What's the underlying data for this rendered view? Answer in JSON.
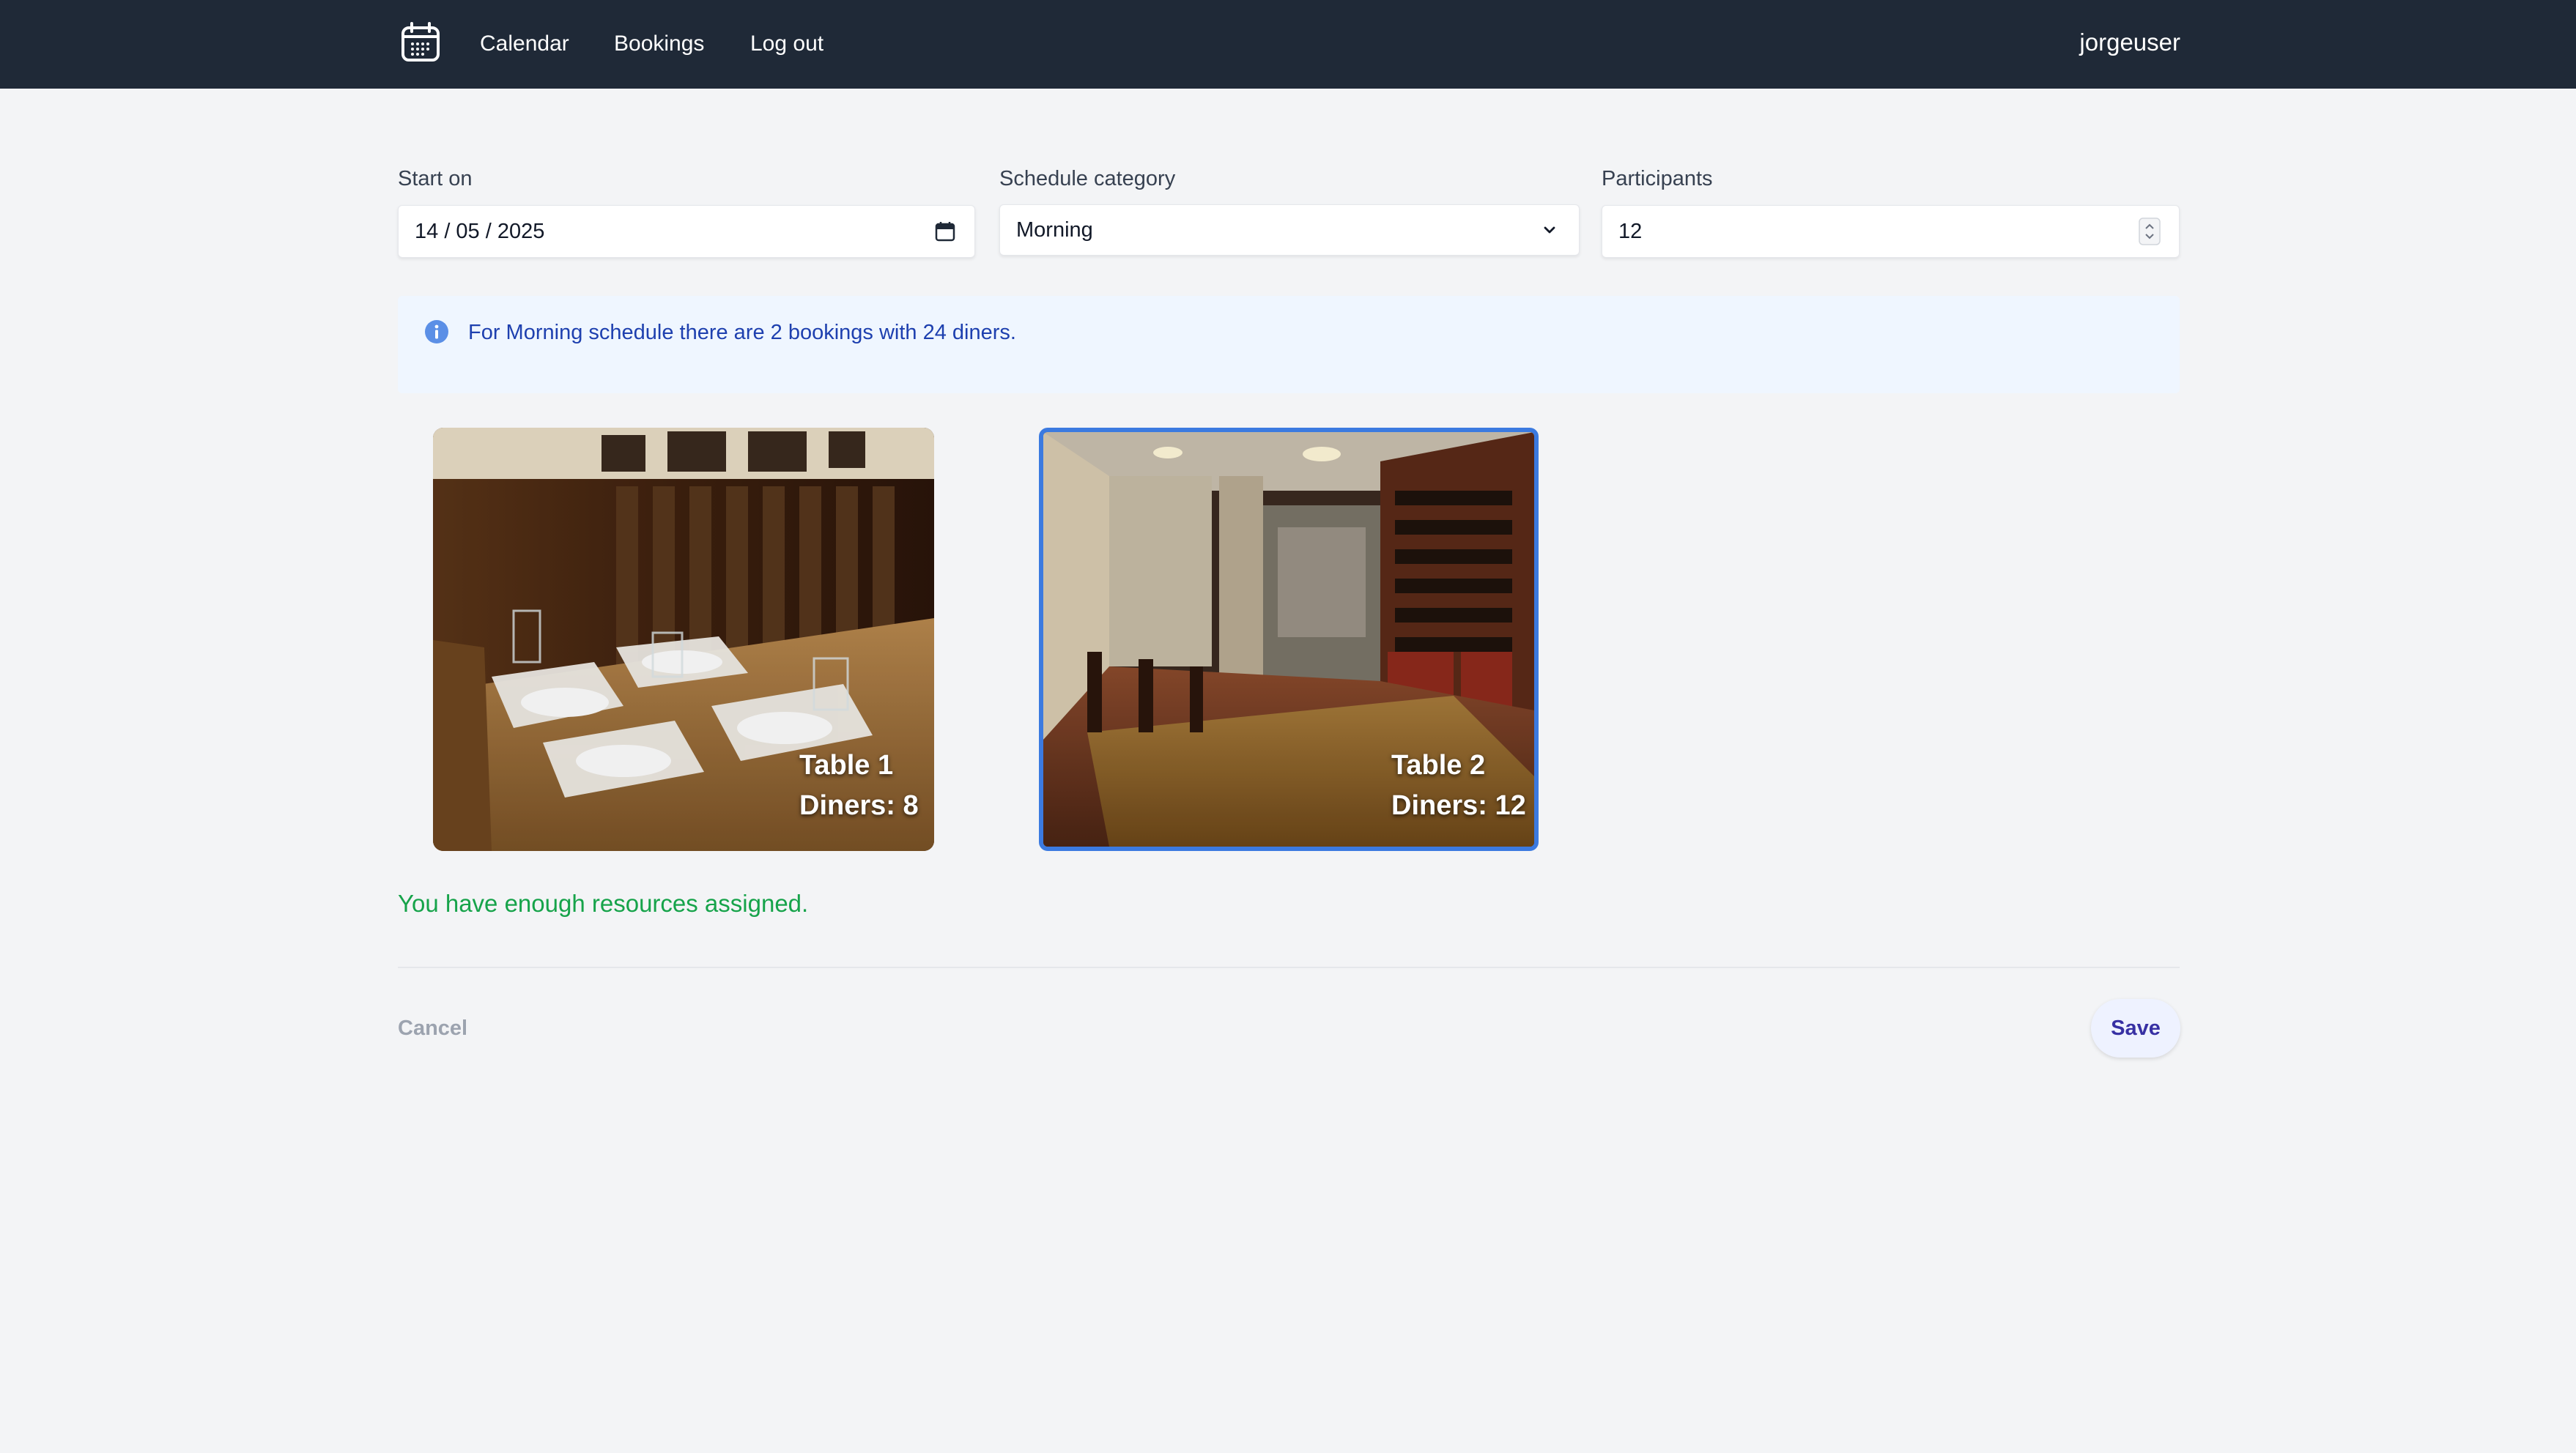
{
  "nav": {
    "logo_icon": "calendar-icon",
    "links": [
      {
        "label": "Calendar"
      },
      {
        "label": "Bookings"
      },
      {
        "label": "Log out"
      }
    ],
    "username": "jorgeuser"
  },
  "form": {
    "start_on": {
      "label": "Start on",
      "value": "14 / 05 / 2025",
      "icon": "calendar-picker-icon"
    },
    "schedule_category": {
      "label": "Schedule category",
      "value": "Morning",
      "icon": "chevron-down-icon"
    },
    "participants": {
      "label": "Participants",
      "value": "12",
      "icon": "stepper-icon"
    }
  },
  "info": {
    "icon": "info-icon",
    "text": "For Morning schedule there are 2 bookings with 24 diners."
  },
  "resources": [
    {
      "title": "Table 1",
      "diners": "Diners: 8",
      "selected": false
    },
    {
      "title": "Table 2",
      "diners": "Diners: 12",
      "selected": true
    }
  ],
  "status": "You have enough resources assigned.",
  "actions": {
    "cancel": "Cancel",
    "save": "Save"
  },
  "colors": {
    "nav_bg": "#1f2937",
    "page_bg": "#f3f4f6",
    "info_bg": "#eff6ff",
    "info_text": "#1e40af",
    "success": "#16a34a",
    "selected_border": "#3b7ae0",
    "save_text": "#3730a3"
  }
}
